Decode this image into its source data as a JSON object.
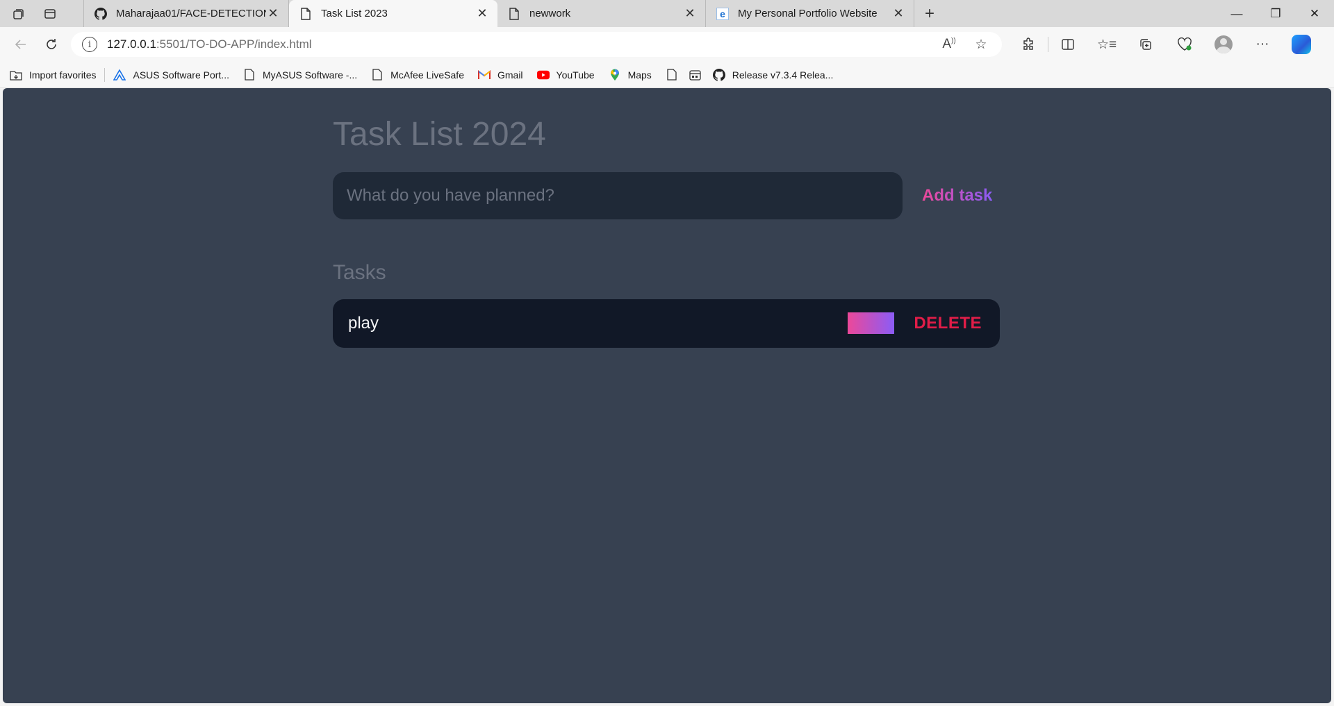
{
  "browser": {
    "tabs": [
      {
        "title": "Maharajaa01/FACE-DETECTION",
        "icon": "github-icon",
        "active": false
      },
      {
        "title": "Task List 2023",
        "icon": "page-icon",
        "active": true
      },
      {
        "title": "newwork",
        "icon": "page-icon",
        "active": false
      },
      {
        "title": "My Personal Portfolio Website",
        "icon": "edge-e-icon",
        "active": false
      }
    ],
    "address": {
      "host": "127.0.0.1",
      "rest": ":5501/TO-DO-APP/index.html"
    },
    "favorites": [
      {
        "label": "Import favorites",
        "icon": "folder-import-icon"
      },
      {
        "label": "ASUS Software Port...",
        "icon": "asus-icon"
      },
      {
        "label": "MyASUS Software -...",
        "icon": "page-icon"
      },
      {
        "label": "McAfee LiveSafe",
        "icon": "page-icon"
      },
      {
        "label": "Gmail",
        "icon": "gmail-icon"
      },
      {
        "label": "YouTube",
        "icon": "youtube-icon"
      },
      {
        "label": "Maps",
        "icon": "maps-icon"
      },
      {
        "label": "",
        "icon": "page-icon"
      },
      {
        "label": "",
        "icon": "calendar-icon"
      },
      {
        "label": "Release v7.3.4 Relea...",
        "icon": "github-icon"
      }
    ]
  },
  "app": {
    "title": "Task List 2024",
    "input_placeholder": "What do you have planned?",
    "add_button": "Add task",
    "tasks_heading": "Tasks",
    "tasks": [
      {
        "text": "play",
        "delete_label": "DELETE"
      }
    ],
    "colors": {
      "background": "#374151",
      "gradient_start": "#ec4899",
      "gradient_end": "#8b5cf6",
      "delete": "#e11d48"
    }
  }
}
